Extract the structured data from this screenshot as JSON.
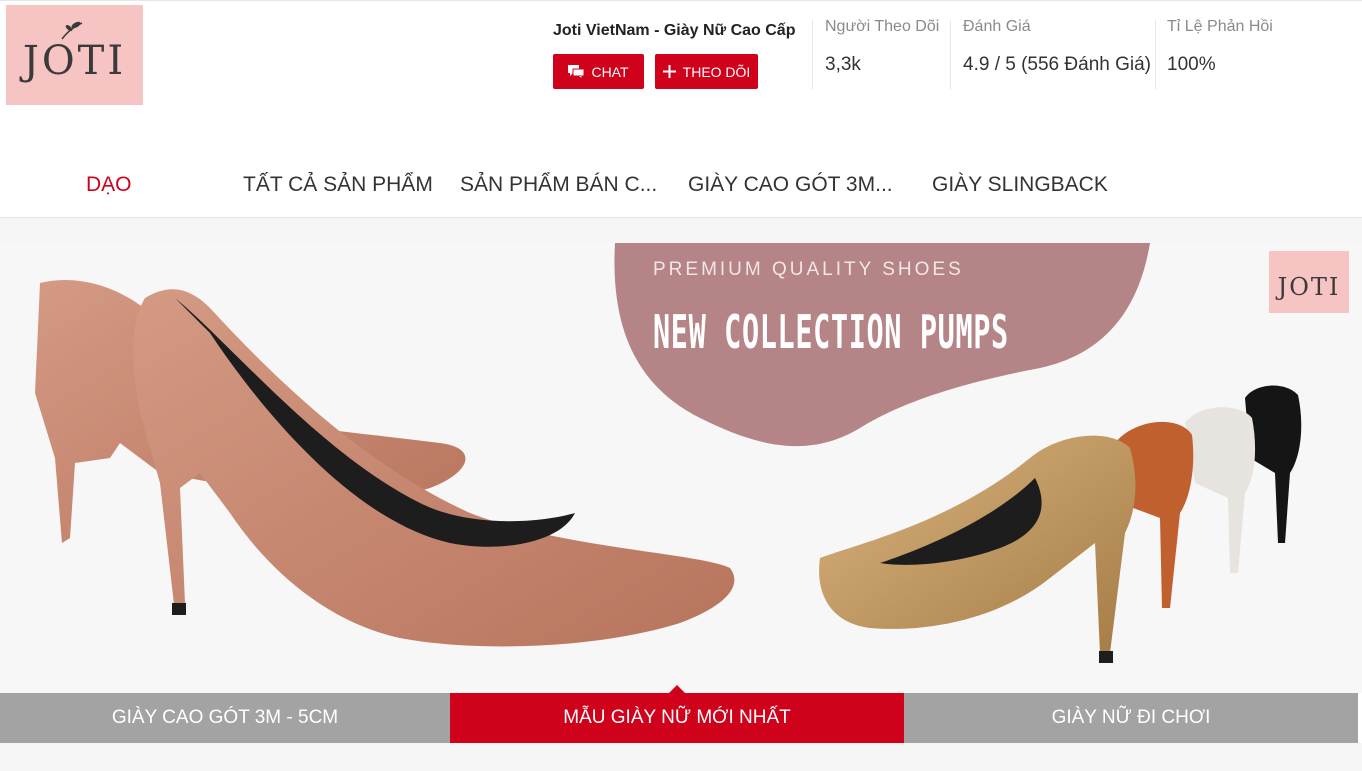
{
  "shop": {
    "logo_text": "JOTI",
    "name": "Joti VietNam - Giày Nữ Cao Cấp",
    "chat_label": "CHAT",
    "follow_label": "THEO DÕI",
    "stats": [
      {
        "label": "Người Theo Dõi",
        "value": "3,3k"
      },
      {
        "label": "Đánh Giá",
        "value": "4.9 / 5 (556 Đánh Giá)"
      },
      {
        "label": "Tỉ Lệ Phản Hồi",
        "value": "100%"
      }
    ]
  },
  "nav": {
    "items": [
      {
        "label": "DẠO"
      },
      {
        "label": "TẤT CẢ SẢN PHẨM"
      },
      {
        "label": "SẢN PHẨM BÁN C..."
      },
      {
        "label": "GIÀY CAO GÓT 3M..."
      },
      {
        "label": "GIÀY SLINGBACK"
      }
    ]
  },
  "banner": {
    "subtitle": "PREMIUM QUALITY SHOES",
    "title": "NEW COLLECTION PUMPS",
    "logo_text": "JOTI"
  },
  "tabs": [
    {
      "label": "GIÀY CAO GÓT 3M - 5CM"
    },
    {
      "label": "MẪU GIÀY NỮ MỚI NHẤT"
    },
    {
      "label": "GIÀY NỮ ĐI CHƠI"
    }
  ],
  "colors": {
    "accent": "#d0011b",
    "logo_bg": "#f7c4c4",
    "blob": "#b58487",
    "tab_inactive": "#a3a3a3"
  }
}
